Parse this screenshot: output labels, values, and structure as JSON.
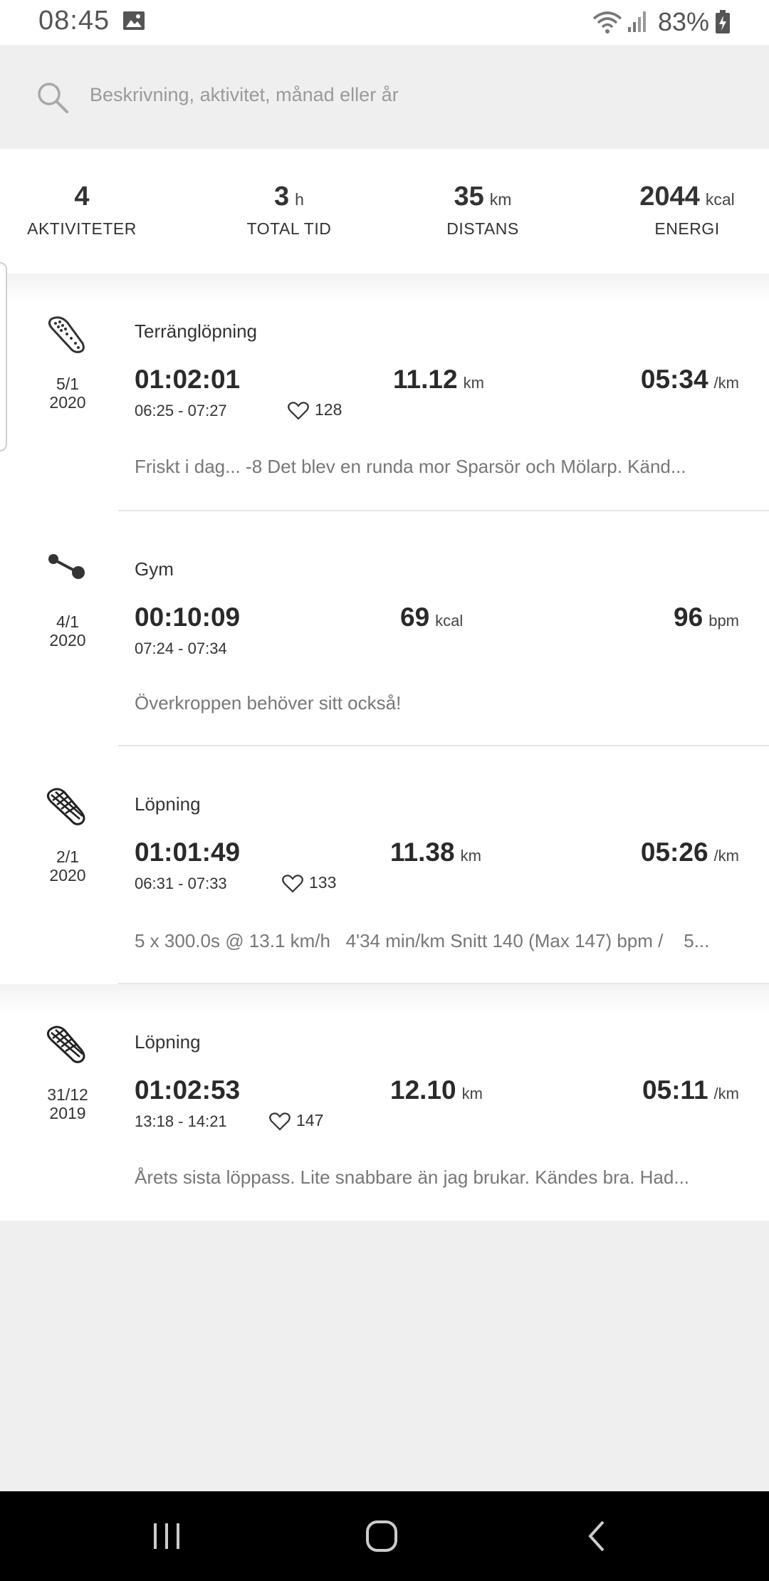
{
  "status": {
    "time": "08:45",
    "battery": "83%"
  },
  "search": {
    "placeholder": "Beskrivning, aktivitet, månad eller år"
  },
  "summary": {
    "activities": {
      "value": "4",
      "unit": "",
      "label": "AKTIVITETER"
    },
    "total_time": {
      "value": "3",
      "unit": "h",
      "label": "TOTAL TID"
    },
    "distance": {
      "value": "35",
      "unit": "km",
      "label": "DISTANS"
    },
    "energy": {
      "value": "2044",
      "unit": "kcal",
      "label": "ENERGI"
    }
  },
  "activities": [
    {
      "icon": "trail-shoe-icon",
      "date_day": "5/1",
      "date_year": "2020",
      "title": "Terränglöpning",
      "duration": "01:02:01",
      "range": "06:25 - 07:27",
      "heart_rate": "128",
      "mid_value": "11.12",
      "mid_unit": "km",
      "right_value": "05:34",
      "right_unit": "/km",
      "description": "Friskt i dag... -8 Det blev en runda mor Sparsör och Mölarp. Känd..."
    },
    {
      "icon": "dumbbell-icon",
      "date_day": "4/1",
      "date_year": "2020",
      "title": "Gym",
      "duration": "00:10:09",
      "range": "07:24 - 07:34",
      "heart_rate": "",
      "mid_value": "69",
      "mid_unit": "kcal",
      "right_value": "96",
      "right_unit": "bpm",
      "description": "Överkroppen behöver sitt också!"
    },
    {
      "icon": "running-shoe-icon",
      "date_day": "2/1",
      "date_year": "2020",
      "title": "Löpning",
      "duration": "01:01:49",
      "range": "06:31 - 07:33",
      "heart_rate": "133",
      "mid_value": "11.38",
      "mid_unit": "km",
      "right_value": "05:26",
      "right_unit": "/km",
      "description": "5 x 300.0s @ 13.1 km/h   4'34 min/km Snitt 140 (Max 147) bpm /    5..."
    },
    {
      "icon": "running-shoe-icon",
      "date_day": "31/12",
      "date_year": "2019",
      "title": "Löpning",
      "duration": "01:02:53",
      "range": "13:18 - 14:21",
      "heart_rate": "147",
      "mid_value": "12.10",
      "mid_unit": "km",
      "right_value": "05:11",
      "right_unit": "/km",
      "description": "Årets sista löppass. Lite snabbare än jag brukar. Kändes bra. Had..."
    }
  ]
}
